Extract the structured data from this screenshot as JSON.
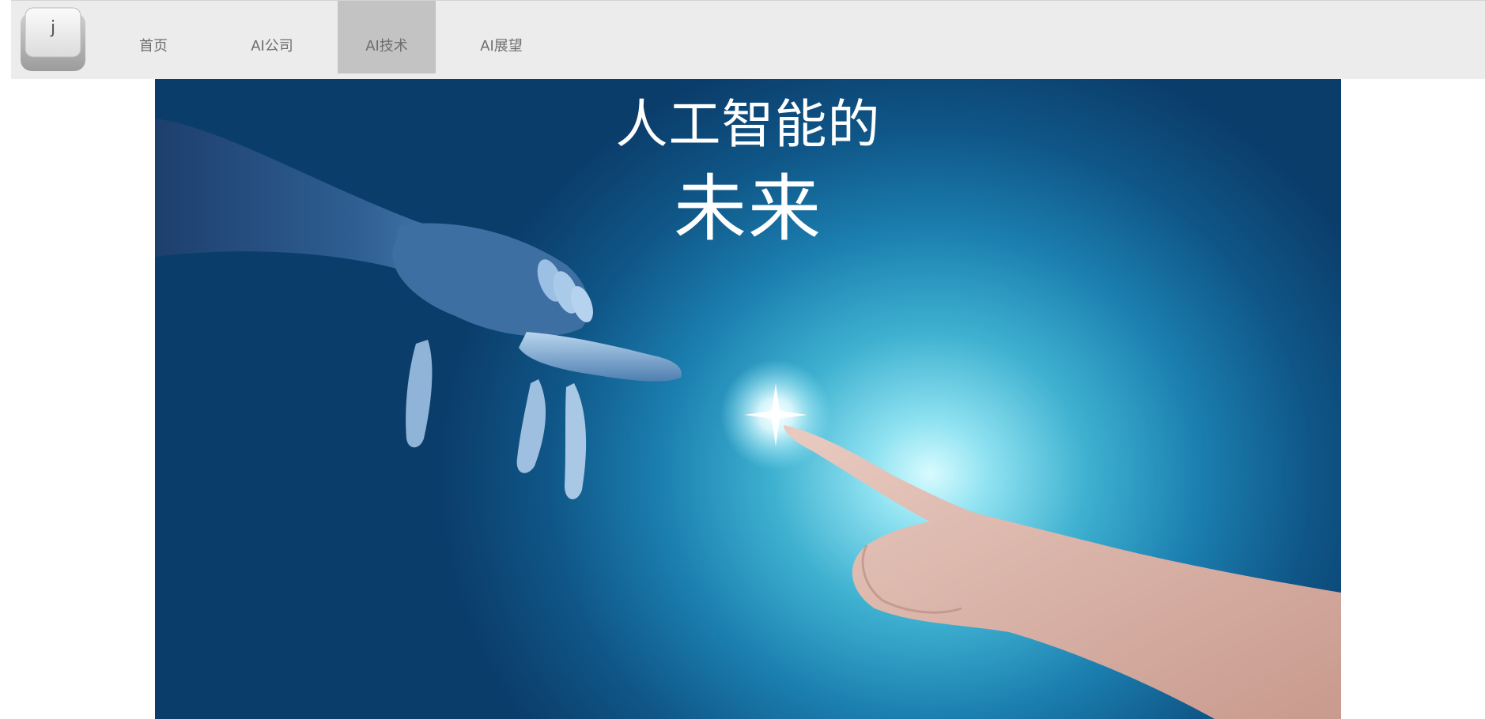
{
  "nav": {
    "items": [
      {
        "label": "首页",
        "active": false
      },
      {
        "label": "AI公司",
        "active": false
      },
      {
        "label": "AI技术",
        "active": true
      },
      {
        "label": "AI展望",
        "active": false
      }
    ],
    "logo": {
      "letter": "j",
      "icon": "keyboard-key-icon"
    }
  },
  "hero": {
    "line1": "人工智能的",
    "line2": "未来"
  },
  "colors": {
    "nav_bg": "#ececec",
    "nav_active_bg": "#c3c3c4",
    "nav_text": "#6e6e6e",
    "hero_dark": "#0b3d6b",
    "hero_glow": "#d8fbff"
  }
}
